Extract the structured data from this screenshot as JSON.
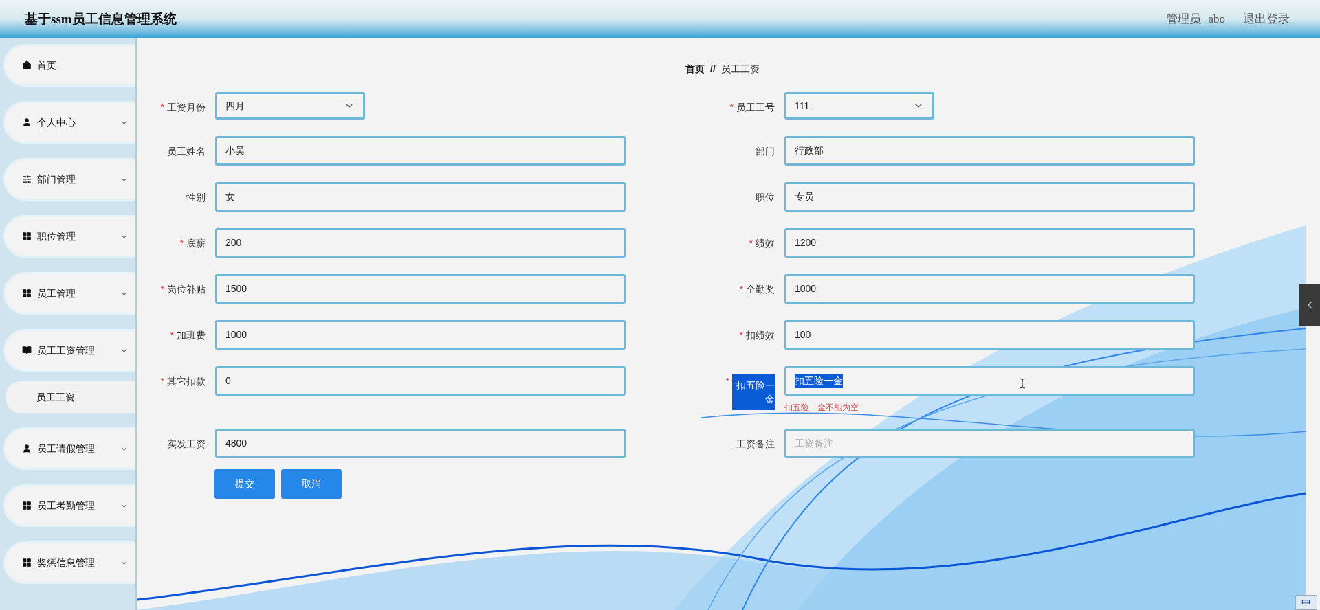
{
  "header": {
    "title": "基于ssm员工信息管理系统",
    "user_role": "管理员",
    "user_name": "abo",
    "logout": "退出登录"
  },
  "sidebar": {
    "items": [
      {
        "label": "首页",
        "kind": "home",
        "expandable": false
      },
      {
        "label": "个人中心",
        "kind": "user",
        "expandable": true
      },
      {
        "label": "部门管理",
        "kind": "sliders",
        "expandable": true
      },
      {
        "label": "职位管理",
        "kind": "grid",
        "expandable": true
      },
      {
        "label": "员工管理",
        "kind": "grid",
        "expandable": true
      },
      {
        "label": "员工工资管理",
        "kind": "book",
        "expandable": true,
        "children": [
          {
            "label": "员工工资"
          }
        ]
      },
      {
        "label": "员工请假管理",
        "kind": "user",
        "expandable": true
      },
      {
        "label": "员工考勤管理",
        "kind": "grid",
        "expandable": true
      },
      {
        "label": "奖惩信息管理",
        "kind": "grid",
        "expandable": true
      }
    ]
  },
  "breadcrumb": {
    "home": "首页",
    "separator": "//",
    "current": "员工工资"
  },
  "form": {
    "rows": [
      {
        "left": {
          "label": "工资月份",
          "required_mark": "*",
          "kind": "select",
          "value": "四月"
        },
        "right": {
          "label": "员工工号",
          "required_mark": "*",
          "kind": "select",
          "value": "111"
        }
      },
      {
        "left": {
          "label": "员工姓名",
          "kind": "input",
          "value": "小吴"
        },
        "right": {
          "label": "部门",
          "kind": "input",
          "value": "行政部"
        }
      },
      {
        "left": {
          "label": "性别",
          "kind": "input",
          "value": "女"
        },
        "right": {
          "label": "职位",
          "kind": "input",
          "value": "专员"
        }
      },
      {
        "left": {
          "label": "底薪",
          "required_mark": "*",
          "kind": "input",
          "value": "200"
        },
        "right": {
          "label": "绩效",
          "required_mark": "*",
          "kind": "input",
          "value": "1200"
        }
      },
      {
        "left": {
          "label": "岗位补贴",
          "required_mark": "*",
          "kind": "input",
          "value": "1500"
        },
        "right": {
          "label": "全勤奖",
          "required_mark": "*",
          "kind": "input",
          "value": "1000"
        }
      },
      {
        "left": {
          "label": "加班费",
          "required_mark": "*",
          "kind": "input",
          "value": "1000"
        },
        "right": {
          "label": "扣绩效",
          "required_mark": "*",
          "kind": "input",
          "value": "100"
        }
      },
      {
        "left": {
          "label": "其它扣款",
          "required_mark": "*",
          "kind": "input",
          "value": "0"
        },
        "right": {
          "label": "扣五险一金",
          "required_mark": "*",
          "kind": "input",
          "value": "扣五险一金",
          "highlighted": true,
          "error": "扣五险一金不能为空"
        }
      },
      {
        "left": {
          "label": "实发工资",
          "kind": "input",
          "value": "4800"
        },
        "right": {
          "label": "工资备注",
          "kind": "input",
          "placeholder": "工资备注"
        }
      }
    ],
    "buttons": [
      "提交",
      "取消"
    ]
  },
  "ime_toolbar": {
    "mode": "中"
  }
}
